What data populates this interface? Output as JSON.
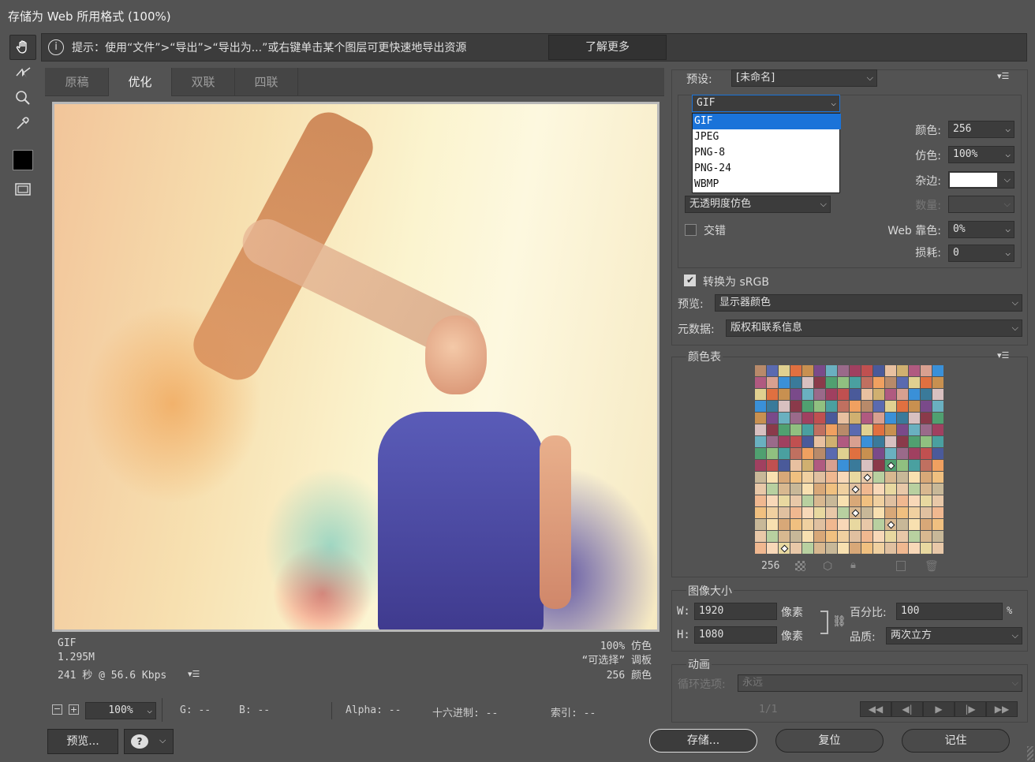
{
  "window": {
    "title": "存储为 Web 所用格式 (100%)"
  },
  "hint": {
    "text": "提示：使用“文件”>“导出”>“导出为...”或右键单击某个图层可更快速地导出资源",
    "learn_more": "了解更多"
  },
  "tabs": [
    "原稿",
    "优化",
    "双联",
    "四联"
  ],
  "selected_tab": "优化",
  "image_info": {
    "format": "GIF",
    "size": "1.295M",
    "time": "241 秒 @ 56.6 Kbps",
    "dither": "100% 仿色",
    "palette": "“可选择” 调板",
    "colors": "256 颜色"
  },
  "status": {
    "zoom": "100%",
    "g": "G: --",
    "b": "B: --",
    "alpha": "Alpha: --",
    "hex": "十六进制: --",
    "index": "索引: --"
  },
  "buttons": {
    "preview": "预览...",
    "save": "存储...",
    "reset": "复位",
    "remember": "记住"
  },
  "settings": {
    "preset_label": "预设:",
    "preset_value": "[未命名]",
    "format_value": "GIF",
    "format_options": [
      "GIF",
      "JPEG",
      "PNG-8",
      "PNG-24",
      "WBMP"
    ],
    "transparency_dither": "无透明度仿色",
    "interlaced": "交错",
    "colors_label": "颜色:",
    "colors_value": "256",
    "dither_label": "仿色:",
    "dither_value": "100%",
    "matte_label": "杂边:",
    "amount_label": "数量:",
    "web_snap_label": "Web 靠色:",
    "web_snap_value": "0%",
    "lossy_label": "损耗:",
    "lossy_value": "0",
    "convert_srgb": "转换为 sRGB",
    "preview_label": "预览:",
    "preview_value": "显示器颜色",
    "metadata_label": "元数据:",
    "metadata_value": "版权和联系信息"
  },
  "color_table": {
    "title": "颜色表",
    "count": "256"
  },
  "image_size": {
    "title": "图像大小",
    "w_label": "W:",
    "w_value": "1920",
    "h_label": "H:",
    "h_value": "1080",
    "unit": "像素",
    "percent_label": "百分比:",
    "percent_value": "100",
    "percent_unit": "%",
    "quality_label": "品质:",
    "quality_value": "两次立方"
  },
  "animation": {
    "title": "动画",
    "loop_label": "循环选项:",
    "loop_value": "永远",
    "frame": "1/1"
  }
}
